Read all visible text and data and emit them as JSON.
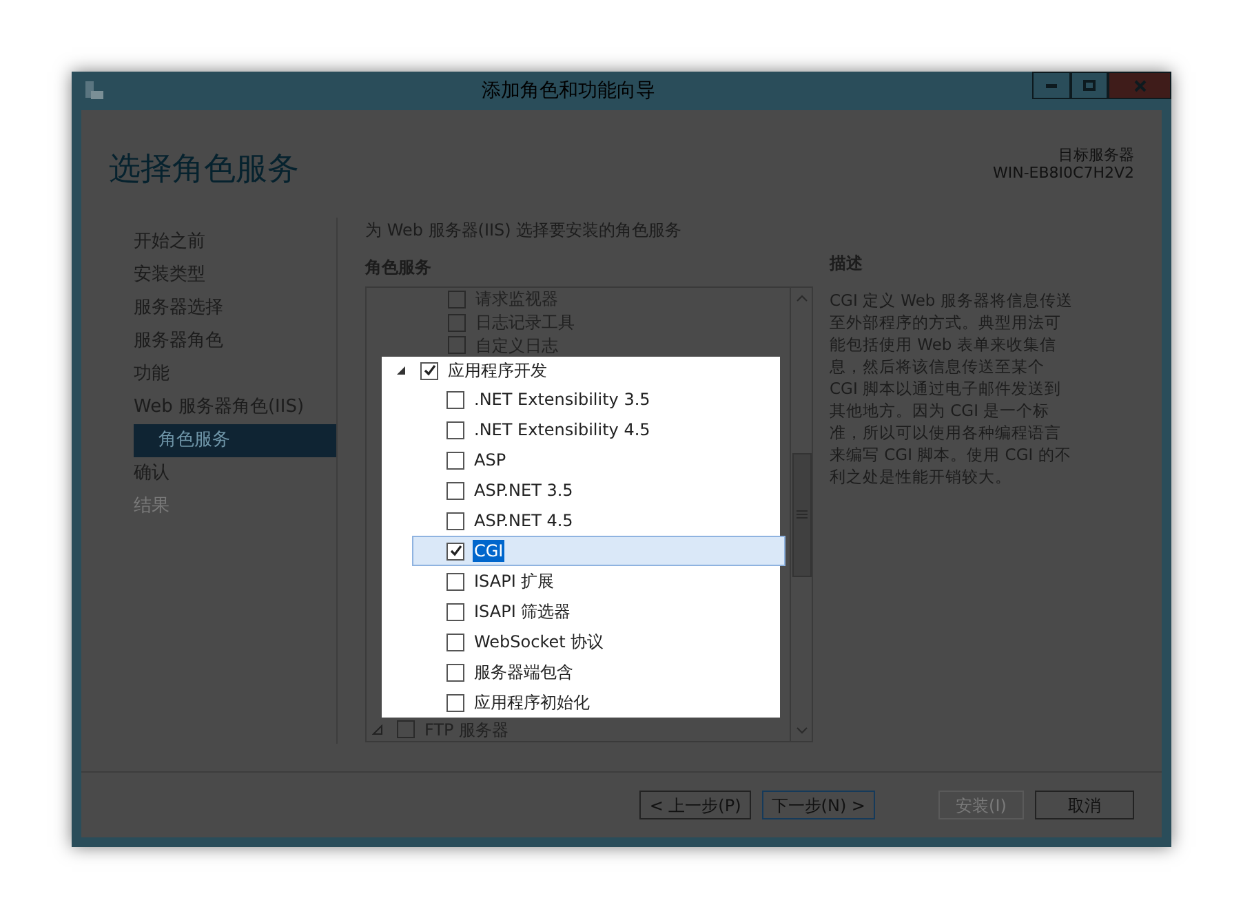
{
  "window": {
    "title": "添加角色和功能向导"
  },
  "header": {
    "title": "选择角色服务",
    "target_label": "目标服务器",
    "target_name": "WIN-EB8I0C7H2V2"
  },
  "sidebar": {
    "items": [
      {
        "label": "开始之前",
        "selected": false,
        "disabled": false
      },
      {
        "label": "安装类型",
        "selected": false,
        "disabled": false
      },
      {
        "label": "服务器选择",
        "selected": false,
        "disabled": false
      },
      {
        "label": "服务器角色",
        "selected": false,
        "disabled": false
      },
      {
        "label": "功能",
        "selected": false,
        "disabled": false
      },
      {
        "label": "Web 服务器角色(IIS)",
        "selected": false,
        "disabled": false,
        "children": [
          {
            "label": "角色服务",
            "selected": true,
            "disabled": false
          }
        ]
      },
      {
        "label": "确认",
        "selected": false,
        "disabled": false
      },
      {
        "label": "结果",
        "selected": false,
        "disabled": true
      }
    ]
  },
  "main": {
    "instruction": "为 Web 服务器(IIS) 选择要安装的角色服务",
    "list_heading": "角色服务",
    "tree_above": [
      {
        "label": "请求监视器",
        "checked": false,
        "selected": false
      },
      {
        "label": "日志记录工具",
        "checked": false,
        "selected": false
      },
      {
        "label": "自定义日志",
        "checked": false,
        "selected": false
      }
    ],
    "tree_focus": {
      "label": "应用程序开发",
      "checked": true,
      "expanded": true,
      "children": [
        {
          "label": ".NET Extensibility 3.5",
          "checked": false,
          "selected": false
        },
        {
          "label": ".NET Extensibility 4.5",
          "checked": false,
          "selected": false
        },
        {
          "label": "ASP",
          "checked": false,
          "selected": false
        },
        {
          "label": "ASP.NET 3.5",
          "checked": false,
          "selected": false
        },
        {
          "label": "ASP.NET 4.5",
          "checked": false,
          "selected": false
        },
        {
          "label": "CGI",
          "checked": true,
          "selected": true
        },
        {
          "label": "ISAPI 扩展",
          "checked": false,
          "selected": false
        },
        {
          "label": "ISAPI 筛选器",
          "checked": false,
          "selected": false
        },
        {
          "label": "WebSocket 协议",
          "checked": false,
          "selected": false
        },
        {
          "label": "服务器端包含",
          "checked": false,
          "selected": false
        },
        {
          "label": "应用程序初始化",
          "checked": false,
          "selected": false
        }
      ]
    },
    "tree_below": [
      {
        "label": "FTP 服务器",
        "checked": false,
        "expanded": false
      }
    ]
  },
  "description": {
    "heading": "描述",
    "text": "CGI 定义 Web 服务器将信息传送至外部程序的方式。典型用法可能包括使用 Web 表单来收集信息，然后将该信息传送至某个 CGI 脚本以通过电子邮件发送到其他地方。因为 CGI 是一个标准，所以可以使用各种编程语言来编写 CGI 脚本。使用 CGI 的不利之处是性能开销较大。"
  },
  "buttons": [
    {
      "label": "< 上一步(P)",
      "disabled": false,
      "focused": false
    },
    {
      "label": "下一步(N) >",
      "disabled": false,
      "focused": true
    },
    {
      "label": "安装(I)",
      "disabled": true,
      "focused": false
    },
    {
      "label": "取消",
      "disabled": false,
      "focused": false
    }
  ]
}
